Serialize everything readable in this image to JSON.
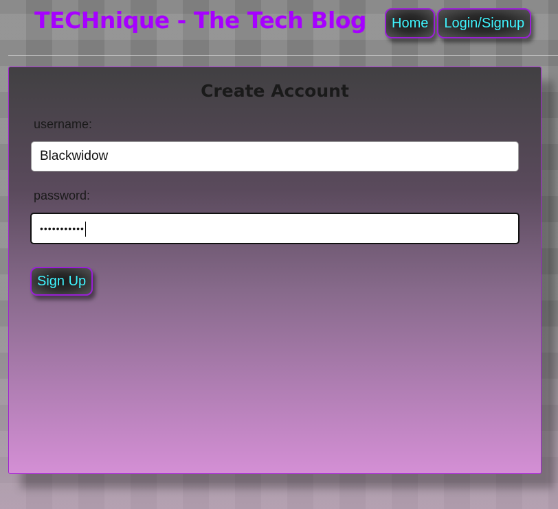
{
  "header": {
    "title": "TECHnique - The Tech Blog",
    "nav": [
      {
        "label": "Home"
      },
      {
        "label": "Login/Signup"
      }
    ]
  },
  "form": {
    "title": "Create Account",
    "username_label": "username:",
    "username_value": "Blackwidow",
    "password_label": "password:",
    "password_value": "•••••••••••",
    "submit_label": "Sign Up"
  },
  "colors": {
    "brand": "#a600ff",
    "button_text": "#3ff5ff",
    "button_border": "#9a1fd6",
    "card_border": "#a020d0"
  }
}
